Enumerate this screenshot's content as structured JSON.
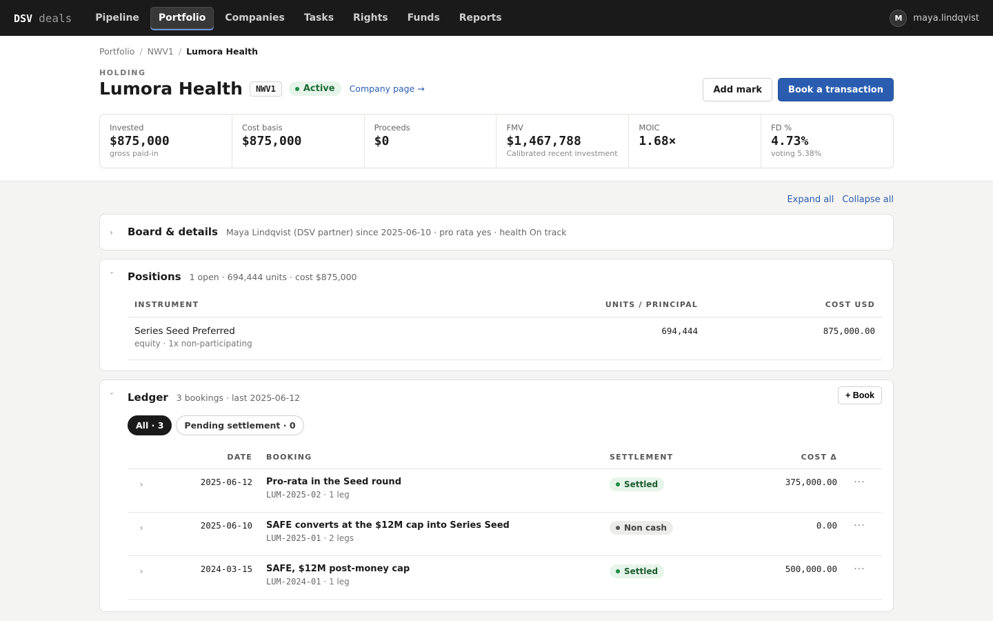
{
  "nav": {
    "brand_primary": "DSV",
    "brand_secondary": "deals",
    "items": [
      {
        "label": "Pipeline"
      },
      {
        "label": "Portfolio"
      },
      {
        "label": "Companies"
      },
      {
        "label": "Tasks"
      },
      {
        "label": "Rights"
      },
      {
        "label": "Funds"
      },
      {
        "label": "Reports"
      }
    ],
    "active": "Portfolio",
    "user": {
      "initial": "M",
      "name": "maya.lindqvist"
    }
  },
  "breadcrumb": [
    "Portfolio",
    "NWV1",
    "Lumora Health"
  ],
  "header": {
    "eyebrow": "HOLDING",
    "title": "Lumora Health",
    "code": "NWV1",
    "status": "Active",
    "company_link": "Company page →",
    "add_mark": "Add mark",
    "book_transaction": "Book a transaction"
  },
  "kpis": [
    {
      "label": "Invested",
      "value": "$875,000",
      "sub": "gross paid-in"
    },
    {
      "label": "Cost basis",
      "value": "$875,000",
      "sub": ""
    },
    {
      "label": "Proceeds",
      "value": "$0",
      "sub": ""
    },
    {
      "label": "FMV",
      "value": "$1,467,788",
      "sub": "Calibrated recent investment"
    },
    {
      "label": "MOIC",
      "value": "1.68×",
      "sub": ""
    },
    {
      "label": "FD %",
      "value": "4.73%",
      "sub": "voting 5.38%"
    }
  ],
  "controls": {
    "expand_all": "Expand all",
    "collapse_all": "Collapse all"
  },
  "board": {
    "title": "Board & details",
    "meta": "Maya Lindqvist (DSV partner) since 2025-06-10 · pro rata yes · health On track"
  },
  "positions": {
    "title": "Positions",
    "meta": "1 open · 694,444 units · cost $875,000",
    "columns": {
      "instrument": "INSTRUMENT",
      "units": "UNITS / PRINCIPAL",
      "cost": "COST USD"
    },
    "rows": [
      {
        "name": "Series Seed Preferred",
        "sub": "equity · 1x non-participating",
        "units": "694,444",
        "cost": "875,000.00"
      }
    ]
  },
  "ledger": {
    "title": "Ledger",
    "meta": "3 bookings · last 2025-06-12",
    "book_button": "+ Book",
    "filters": [
      {
        "label": "All · 3",
        "active": true
      },
      {
        "label": "Pending settlement · 0",
        "active": false
      }
    ],
    "columns": {
      "date": "DATE",
      "booking": "BOOKING",
      "settlement": "SETTLEMENT",
      "cost": "COST Δ"
    },
    "rows": [
      {
        "date": "2025-06-12",
        "title": "Pro-rata in the Seed round",
        "ref": "LUM-2025-02",
        "legs": "1 leg",
        "settlement": "Settled",
        "cost": "375,000.00"
      },
      {
        "date": "2025-06-10",
        "title": "SAFE converts at the $12M cap into Series Seed",
        "ref": "LUM-2025-01",
        "legs": "2 legs",
        "settlement": "Non cash",
        "cost": "0.00"
      },
      {
        "date": "2024-03-15",
        "title": "SAFE, $12M post-money cap",
        "ref": "LUM-2024-01",
        "legs": "1 leg",
        "settlement": "Settled",
        "cost": "500,000.00"
      }
    ]
  }
}
